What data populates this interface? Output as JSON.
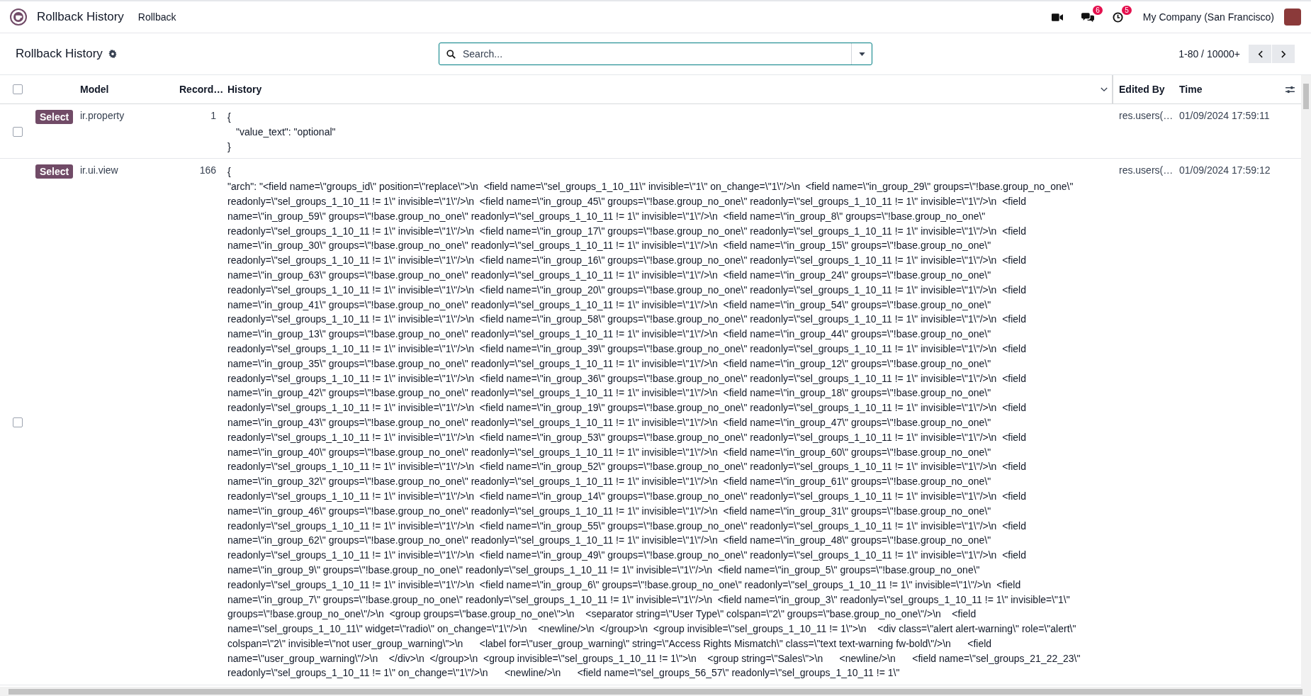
{
  "navbar": {
    "app_title": "Rollback History",
    "menu_items": [
      {
        "label": "Rollback"
      }
    ],
    "systray": [
      {
        "kind": "video"
      },
      {
        "kind": "chat",
        "badge": "6"
      },
      {
        "kind": "activity",
        "badge": "5"
      }
    ],
    "company": "My Company (San Francisco)"
  },
  "control_panel": {
    "title": "Rollback History",
    "search": {
      "placeholder": "Search..."
    },
    "pager": "1-80 / 10000+"
  },
  "table": {
    "all_selected": false,
    "columns": [
      "Model",
      "Record…",
      "History",
      "Edited By",
      "Time"
    ],
    "rows": [
      {
        "selected": false,
        "action": "Select",
        "model": "ir.property",
        "record": "1",
        "history": [
          "{",
          "\"value_text\": \"optional\"",
          "}"
        ],
        "edited_by": "res.users(…",
        "time": "01/09/2024 17:59:11"
      },
      {
        "selected": false,
        "action": "Select",
        "model": "ir.ui.view",
        "record": "166",
        "history": [
          "{",
          "\"arch\": \"<field name=\\\"groups_id\\\" position=\\\"replace\\\">\\n  <field name=\\\"sel_groups_1_10_11\\\" invisible=\\\"1\\\" on_change=\\\"1\\\"/>\\n  <field name=\\\"in_group_29\\\" groups=\\\"!base.group_no_one\\\" readonly=\\\"sel_groups_1_10_11 != 1\\\" invisible=\\\"1\\\"/>\\n  <field name=\\\"in_group_45\\\" groups=\\\"!base.group_no_one\\\" readonly=\\\"sel_groups_1_10_11 != 1\\\" invisible=\\\"1\\\"/>\\n  <field name=\\\"in_group_59\\\" groups=\\\"!base.group_no_one\\\" readonly=\\\"sel_groups_1_10_11 != 1\\\" invisible=\\\"1\\\"/>\\n  <field name=\\\"in_group_8\\\" groups=\\\"!base.group_no_one\\\" readonly=\\\"sel_groups_1_10_11 != 1\\\" invisible=\\\"1\\\"/>\\n  <field name=\\\"in_group_17\\\" groups=\\\"!base.group_no_one\\\" readonly=\\\"sel_groups_1_10_11 != 1\\\" invisible=\\\"1\\\"/>\\n  <field name=\\\"in_group_30\\\" groups=\\\"!base.group_no_one\\\" readonly=\\\"sel_groups_1_10_11 != 1\\\" invisible=\\\"1\\\"/>\\n  <field name=\\\"in_group_15\\\" groups=\\\"!base.group_no_one\\\" readonly=\\\"sel_groups_1_10_11 != 1\\\" invisible=\\\"1\\\"/>\\n  <field name=\\\"in_group_16\\\" groups=\\\"!base.group_no_one\\\" readonly=\\\"sel_groups_1_10_11 != 1\\\" invisible=\\\"1\\\"/>\\n  <field name=\\\"in_group_63\\\" groups=\\\"!base.group_no_one\\\" readonly=\\\"sel_groups_1_10_11 != 1\\\" invisible=\\\"1\\\"/>\\n  <field name=\\\"in_group_24\\\" groups=\\\"!base.group_no_one\\\" readonly=\\\"sel_groups_1_10_11 != 1\\\" invisible=\\\"1\\\"/>\\n  <field name=\\\"in_group_20\\\" groups=\\\"!base.group_no_one\\\" readonly=\\\"sel_groups_1_10_11 != 1\\\" invisible=\\\"1\\\"/>\\n  <field name=\\\"in_group_41\\\" groups=\\\"!base.group_no_one\\\" readonly=\\\"sel_groups_1_10_11 != 1\\\" invisible=\\\"1\\\"/>\\n  <field name=\\\"in_group_54\\\" groups=\\\"!base.group_no_one\\\" readonly=\\\"sel_groups_1_10_11 != 1\\\" invisible=\\\"1\\\"/>\\n  <field name=\\\"in_group_58\\\" groups=\\\"!base.group_no_one\\\" readonly=\\\"sel_groups_1_10_11 != 1\\\" invisible=\\\"1\\\"/>\\n  <field name=\\\"in_group_13\\\" groups=\\\"!base.group_no_one\\\" readonly=\\\"sel_groups_1_10_11 != 1\\\" invisible=\\\"1\\\"/>\\n  <field name=\\\"in_group_44\\\" groups=\\\"!base.group_no_one\\\" readonly=\\\"sel_groups_1_10_11 != 1\\\" invisible=\\\"1\\\"/>\\n  <field name=\\\"in_group_39\\\" groups=\\\"!base.group_no_one\\\" readonly=\\\"sel_groups_1_10_11 != 1\\\" invisible=\\\"1\\\"/>\\n  <field name=\\\"in_group_35\\\" groups=\\\"!base.group_no_one\\\" readonly=\\\"sel_groups_1_10_11 != 1\\\" invisible=\\\"1\\\"/>\\n  <field name=\\\"in_group_12\\\" groups=\\\"!base.group_no_one\\\" readonly=\\\"sel_groups_1_10_11 != 1\\\" invisible=\\\"1\\\"/>\\n  <field name=\\\"in_group_36\\\" groups=\\\"!base.group_no_one\\\" readonly=\\\"sel_groups_1_10_11 != 1\\\" invisible=\\\"1\\\"/>\\n  <field name=\\\"in_group_42\\\" groups=\\\"!base.group_no_one\\\" readonly=\\\"sel_groups_1_10_11 != 1\\\" invisible=\\\"1\\\"/>\\n  <field name=\\\"in_group_18\\\" groups=\\\"!base.group_no_one\\\" readonly=\\\"sel_groups_1_10_11 != 1\\\" invisible=\\\"1\\\"/>\\n  <field name=\\\"in_group_19\\\" groups=\\\"!base.group_no_one\\\" readonly=\\\"sel_groups_1_10_11 != 1\\\" invisible=\\\"1\\\"/>\\n  <field name=\\\"in_group_43\\\" groups=\\\"!base.group_no_one\\\" readonly=\\\"sel_groups_1_10_11 != 1\\\" invisible=\\\"1\\\"/>\\n  <field name=\\\"in_group_47\\\" groups=\\\"!base.group_no_one\\\" readonly=\\\"sel_groups_1_10_11 != 1\\\" invisible=\\\"1\\\"/>\\n  <field name=\\\"in_group_53\\\" groups=\\\"!base.group_no_one\\\" readonly=\\\"sel_groups_1_10_11 != 1\\\" invisible=\\\"1\\\"/>\\n  <field name=\\\"in_group_40\\\" groups=\\\"!base.group_no_one\\\" readonly=\\\"sel_groups_1_10_11 != 1\\\" invisible=\\\"1\\\"/>\\n  <field name=\\\"in_group_60\\\" groups=\\\"!base.group_no_one\\\" readonly=\\\"sel_groups_1_10_11 != 1\\\" invisible=\\\"1\\\"/>\\n  <field name=\\\"in_group_52\\\" groups=\\\"!base.group_no_one\\\" readonly=\\\"sel_groups_1_10_11 != 1\\\" invisible=\\\"1\\\"/>\\n  <field name=\\\"in_group_32\\\" groups=\\\"!base.group_no_one\\\" readonly=\\\"sel_groups_1_10_11 != 1\\\" invisible=\\\"1\\\"/>\\n  <field name=\\\"in_group_61\\\" groups=\\\"!base.group_no_one\\\" readonly=\\\"sel_groups_1_10_11 != 1\\\" invisible=\\\"1\\\"/>\\n  <field name=\\\"in_group_14\\\" groups=\\\"!base.group_no_one\\\" readonly=\\\"sel_groups_1_10_11 != 1\\\" invisible=\\\"1\\\"/>\\n  <field name=\\\"in_group_46\\\" groups=\\\"!base.group_no_one\\\" readonly=\\\"sel_groups_1_10_11 != 1\\\" invisible=\\\"1\\\"/>\\n  <field name=\\\"in_group_31\\\" groups=\\\"!base.group_no_one\\\" readonly=\\\"sel_groups_1_10_11 != 1\\\" invisible=\\\"1\\\"/>\\n  <field name=\\\"in_group_55\\\" groups=\\\"!base.group_no_one\\\" readonly=\\\"sel_groups_1_10_11 != 1\\\" invisible=\\\"1\\\"/>\\n  <field name=\\\"in_group_62\\\" groups=\\\"!base.group_no_one\\\" readonly=\\\"sel_groups_1_10_11 != 1\\\" invisible=\\\"1\\\"/>\\n  <field name=\\\"in_group_48\\\" groups=\\\"!base.group_no_one\\\" readonly=\\\"sel_groups_1_10_11 != 1\\\" invisible=\\\"1\\\"/>\\n  <field name=\\\"in_group_49\\\" groups=\\\"!base.group_no_one\\\" readonly=\\\"sel_groups_1_10_11 != 1\\\" invisible=\\\"1\\\"/>\\n  <field name=\\\"in_group_9\\\" groups=\\\"!base.group_no_one\\\" readonly=\\\"sel_groups_1_10_11 != 1\\\" invisible=\\\"1\\\"/>\\n  <field name=\\\"in_group_5\\\" groups=\\\"!base.group_no_one\\\" readonly=\\\"sel_groups_1_10_11 != 1\\\" invisible=\\\"1\\\"/>\\n  <field name=\\\"in_group_6\\\" groups=\\\"!base.group_no_one\\\" readonly=\\\"sel_groups_1_10_11 != 1\\\" invisible=\\\"1\\\"/>\\n  <field name=\\\"in_group_7\\\" groups=\\\"!base.group_no_one\\\" readonly=\\\"sel_groups_1_10_11 != 1\\\" invisible=\\\"1\\\"/>\\n  <field name=\\\"in_group_3\\\" readonly=\\\"sel_groups_1_10_11 != 1\\\" invisible=\\\"1\\\" groups=\\\"!base.group_no_one\\\"/>\\n  <group groups=\\\"base.group_no_one\\\">\\n    <separator string=\\\"User Type\\\" colspan=\\\"2\\\" groups=\\\"base.group_no_one\\\"/>\\n    <field name=\\\"sel_groups_1_10_11\\\" widget=\\\"radio\\\" on_change=\\\"1\\\"/>\\n    <newline/>\\n  </group>\\n  <group invisible=\\\"sel_groups_1_10_11 != 1\\\">\\n    <div class=\\\"alert alert-warning\\\" role=\\\"alert\\\" colspan=\\\"2\\\" invisible=\\\"not user_group_warning\\\">\\n      <label for=\\\"user_group_warning\\\" string=\\\"Access Rights Mismatch\\\" class=\\\"text text-warning fw-bold\\\"/>\\n      <field name=\\\"user_group_warning\\\"/>\\n    </div>\\n  </group>\\n  <group invisible=\\\"sel_groups_1_10_11 != 1\\\">\\n    <group string=\\\"Sales\\\">\\n      <newline/>\\n      <field name=\\\"sel_groups_21_22_23\\\" readonly=\\\"sel_groups_1_10_11 != 1\\\" on_change=\\\"1\\\"/>\\n      <newline/>\\n      <field name=\\\"sel_groups_56_57\\\" readonly=\\\"sel_groups_1_10_11 != 1\\\""
        ],
        "edited_by": "res.users(…",
        "time": "01/09/2024 17:59:12"
      }
    ]
  }
}
